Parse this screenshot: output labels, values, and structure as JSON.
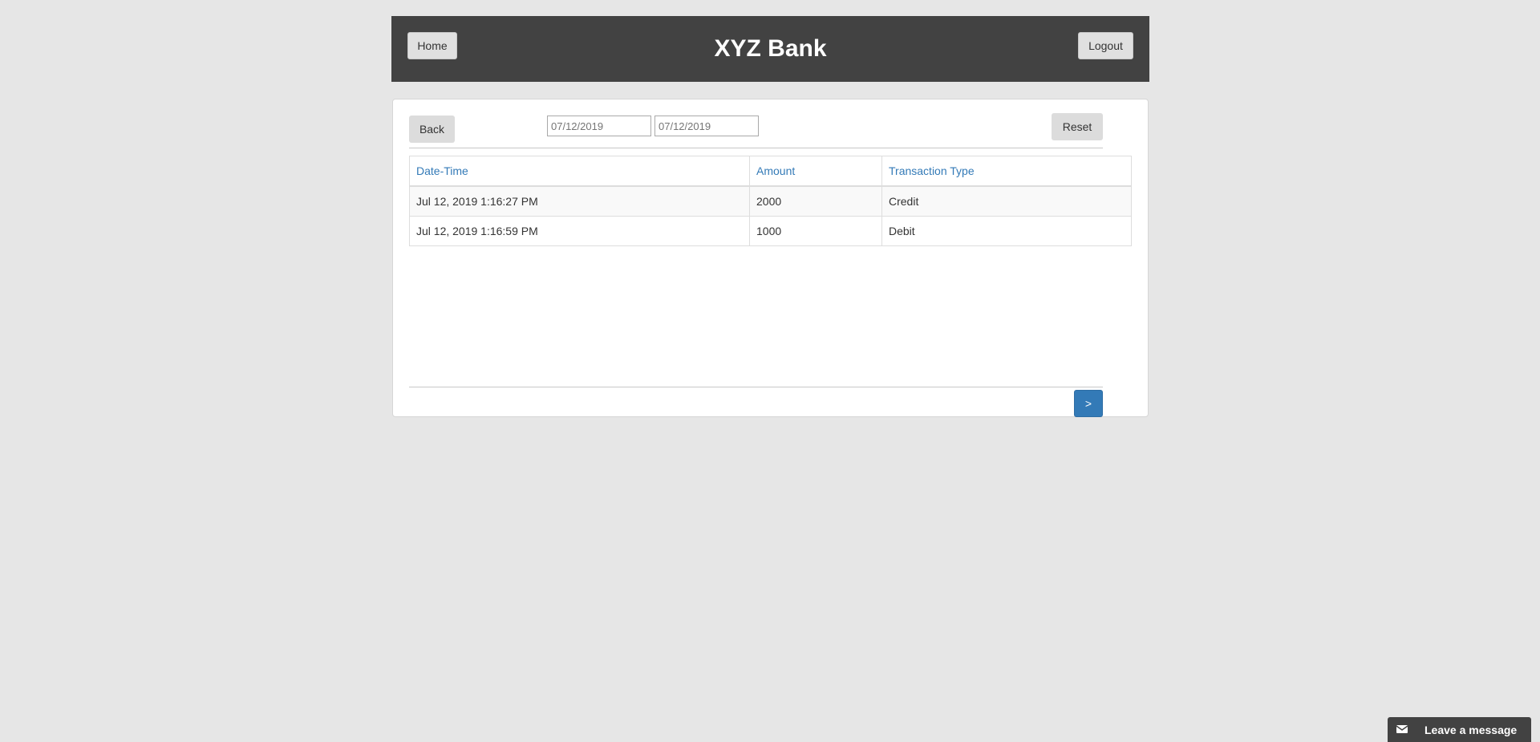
{
  "header": {
    "title": "XYZ Bank",
    "home_label": "Home",
    "logout_label": "Logout"
  },
  "filters": {
    "back_label": "Back",
    "from_date": "07/12/2019",
    "to_date": "07/12/2019",
    "reset_label": "Reset"
  },
  "table": {
    "columns": [
      "Date-Time",
      "Amount",
      "Transaction Type"
    ],
    "rows": [
      {
        "date_time": "Jul 12, 2019 1:16:27 PM",
        "amount": "2000",
        "type": "Credit"
      },
      {
        "date_time": "Jul 12, 2019 1:16:59 PM",
        "amount": "1000",
        "type": "Debit"
      }
    ]
  },
  "pagination": {
    "next_label": ">"
  },
  "chat": {
    "label": "Leave a message",
    "icon": "envelope-icon"
  },
  "colors": {
    "page_bg": "#e6e6e6",
    "header_bg": "#424242",
    "link_blue": "#337ab7",
    "primary_button": "#337ab7"
  }
}
